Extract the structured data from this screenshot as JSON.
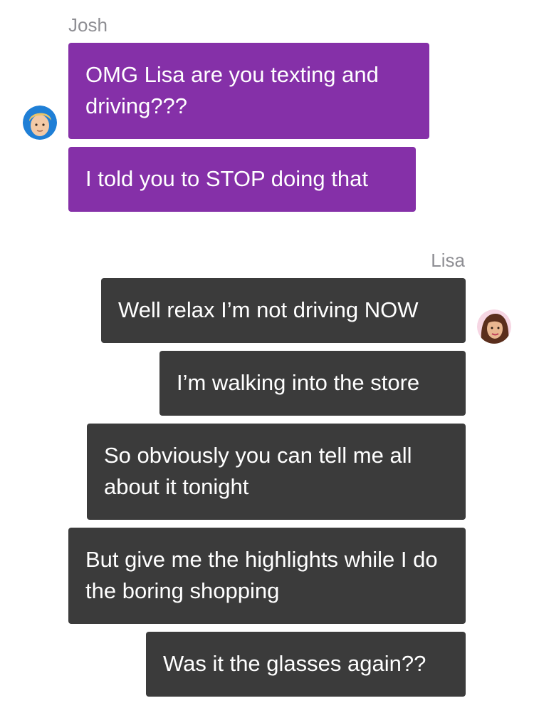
{
  "conversation": {
    "incoming": {
      "sender": "Josh",
      "avatar_icon": "josh-avatar-icon",
      "color": "#8530a8",
      "messages": [
        "OMG Lisa are you texting and driving???",
        "I told you to STOP doing that"
      ]
    },
    "outgoing": {
      "sender": "Lisa",
      "avatar_icon": "lisa-avatar-icon",
      "color": "#3b3b3b",
      "messages": [
        "Well relax I’m not driving NOW",
        "I’m walking into the store",
        "So obviously you can tell me all about it tonight",
        "But give me the highlights while I do the boring shopping",
        "Was it the glasses again??"
      ]
    }
  }
}
